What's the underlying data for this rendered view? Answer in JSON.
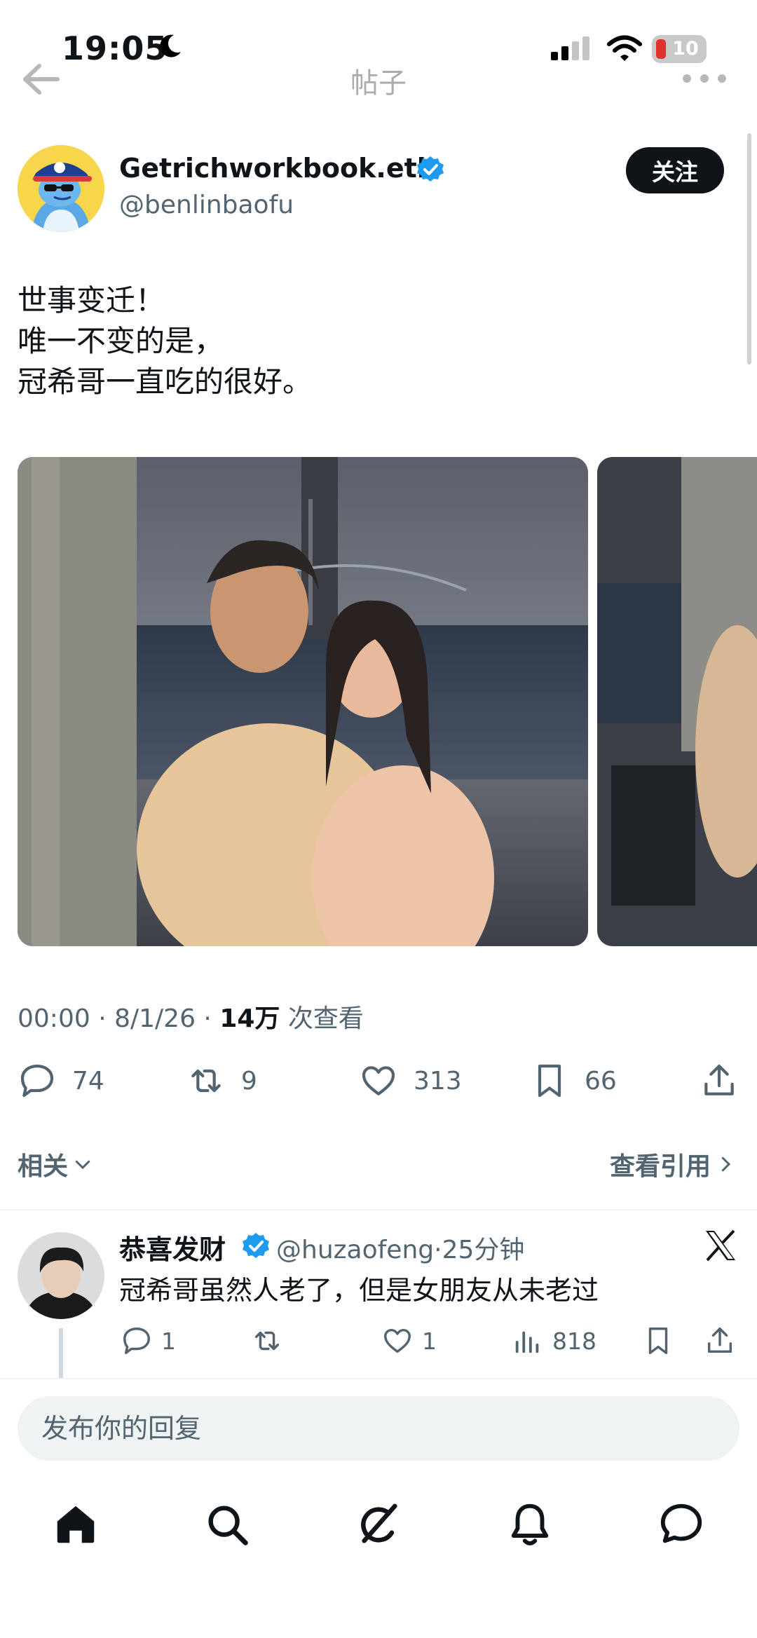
{
  "status_bar": {
    "time": "19:05",
    "battery": "10"
  },
  "nav": {
    "title": "帖子"
  },
  "post": {
    "display_name": "Getrichworkbook.eth",
    "handle": "@benlinbaofu",
    "follow_label": "关注",
    "text": "世事变迁！\n唯一不变的是，\n冠希哥一直吃的很好。",
    "time": "00:00",
    "date": "8/1/26",
    "views": "14万",
    "views_label": "次查看",
    "stats": {
      "replies": "74",
      "reposts": "9",
      "likes": "313",
      "bookmarks": "66"
    }
  },
  "related": {
    "label": "相关",
    "quotes_label": "查看引用"
  },
  "reply": {
    "name": "恭喜发财",
    "handle": "@huzaofeng",
    "time": "25分钟",
    "text": "冠希哥虽然人老了，但是女朋友从未老过",
    "stats": {
      "replies": "1",
      "likes": "1",
      "views": "818"
    }
  },
  "composer": {
    "placeholder": "发布你的回复"
  },
  "icons": {
    "verified": "verified-badge-icon",
    "reply": "reply-icon",
    "repost": "repost-icon",
    "like": "heart-icon",
    "bookmark": "bookmark-icon",
    "share": "share-icon",
    "views": "views-bar-icon",
    "x_logo": "x-logo-icon",
    "tabs": [
      "home-icon",
      "search-icon",
      "grok-icon",
      "notifications-icon",
      "messages-icon"
    ]
  },
  "colors": {
    "verified": "#1d9bf0",
    "text": "#0f1419",
    "secondary": "#536471"
  }
}
